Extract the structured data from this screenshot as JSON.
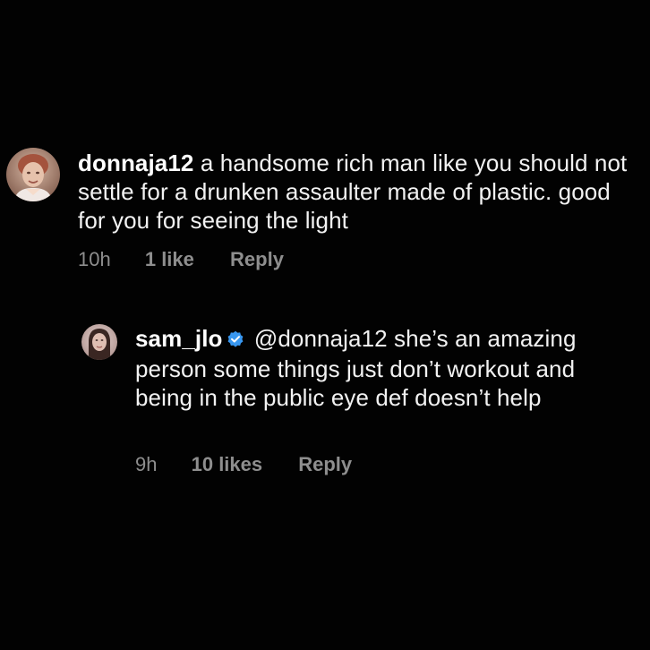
{
  "comments": [
    {
      "username": "donnaja12",
      "text": "a handsome rich man like you should not settle for a drunken assaulter made of plastic. good for you for seeing the light",
      "time": "10h",
      "likes": "1 like",
      "reply_label": "Reply",
      "avatar_icon": "profile-photo-older-woman"
    },
    {
      "username": "sam_jlo",
      "verified": true,
      "verified_icon": "verified-badge-icon",
      "verified_color": "#3897f0",
      "text": "@donnaja12 she’s an amazing person some things just don’t workout and being in the public eye def doesn’t help",
      "time": "9h",
      "likes": "10 likes",
      "reply_label": "Reply",
      "avatar_icon": "profile-photo-woman-dark-hair"
    }
  ],
  "colors": {
    "background": "#000000",
    "text": "#f2f2f2",
    "meta": "#8e8e8e"
  }
}
